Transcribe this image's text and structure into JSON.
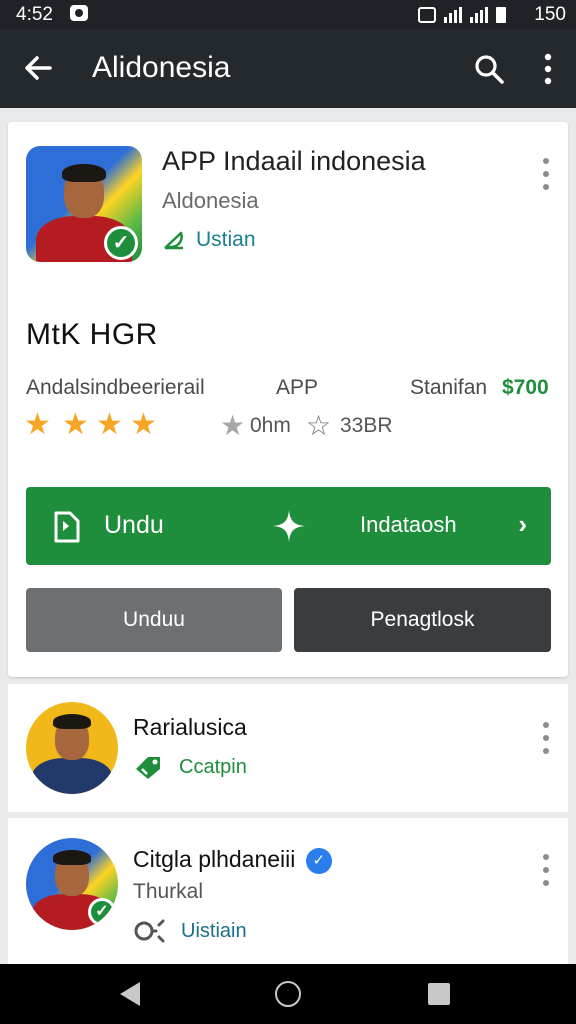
{
  "status_bar": {
    "time": "4:52",
    "battery": "150"
  },
  "app_bar": {
    "title": "Alidonesia",
    "back_icon": "arrow-left-icon",
    "search_icon": "search-icon",
    "more_icon": "more-vert-icon"
  },
  "app": {
    "name": "APP Indaail indonesia",
    "developer": "Aldonesia",
    "verify_label": "Ustian",
    "section_title": "MtK HGR",
    "meta_left": "Andalsindbeerierail",
    "meta_mid": "APP",
    "meta_right": "Stanifan",
    "price": "$700",
    "stars_filled": 4,
    "downloads": "0hm",
    "rating_count": "33BR"
  },
  "buttons": {
    "primary_left": "Undu",
    "primary_right": "Indataosh",
    "secondary_gray": "Unduu",
    "secondary_dark": "Penagtlosk"
  },
  "list": [
    {
      "title": "Rarialusica",
      "sub": "",
      "action": "Ccatpin"
    },
    {
      "title": "Citgla plhdaneiii",
      "sub": "Thurkal",
      "action": "Uistiain"
    }
  ],
  "colors": {
    "primary_green": "#1f8e3c",
    "app_bar": "#24292e",
    "teal": "#1b6f86",
    "verified_blue": "#2b7de9"
  }
}
